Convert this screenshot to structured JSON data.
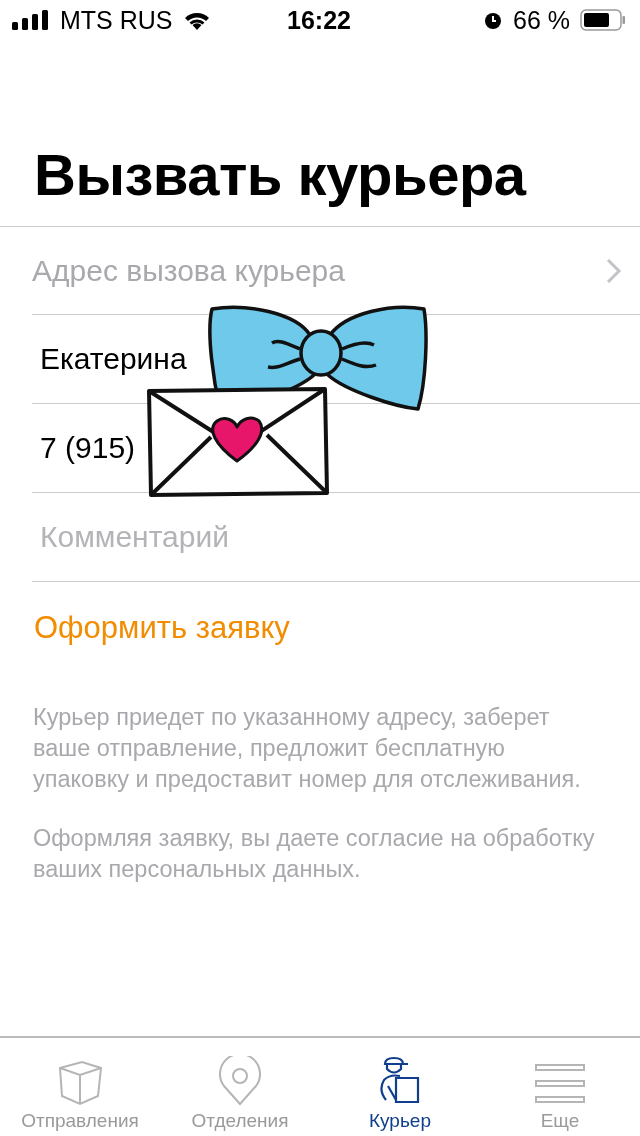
{
  "status_bar": {
    "carrier": "MTS RUS",
    "time": "16:22",
    "battery": "66 %"
  },
  "title": "Вызвать курьера",
  "form": {
    "address": {
      "placeholder": "Адрес вызова курьера"
    },
    "fields": [
      {
        "kind": "text",
        "value": "Екатерина"
      },
      {
        "kind": "text",
        "value": "7 (915)"
      },
      {
        "kind": "text",
        "placeholder": "Комментарий"
      }
    ]
  },
  "submit": "Оформить заявку",
  "notes": [
    "Курьер приедет по указанному адресу, заберет ваше отправление, предложит бесплатную упаковку и предоставит номер для отслеживания.",
    "Оформляя заявку, вы даете согласие на обработку ваших персональных данных."
  ],
  "tabs": [
    {
      "kind": "parcels",
      "label": "Отправления",
      "selected": false
    },
    {
      "kind": "offices",
      "label": "Отделения",
      "selected": false
    },
    {
      "kind": "courier",
      "label": "Курьер",
      "selected": true
    },
    {
      "kind": "more",
      "label": "Еще",
      "selected": false
    }
  ]
}
